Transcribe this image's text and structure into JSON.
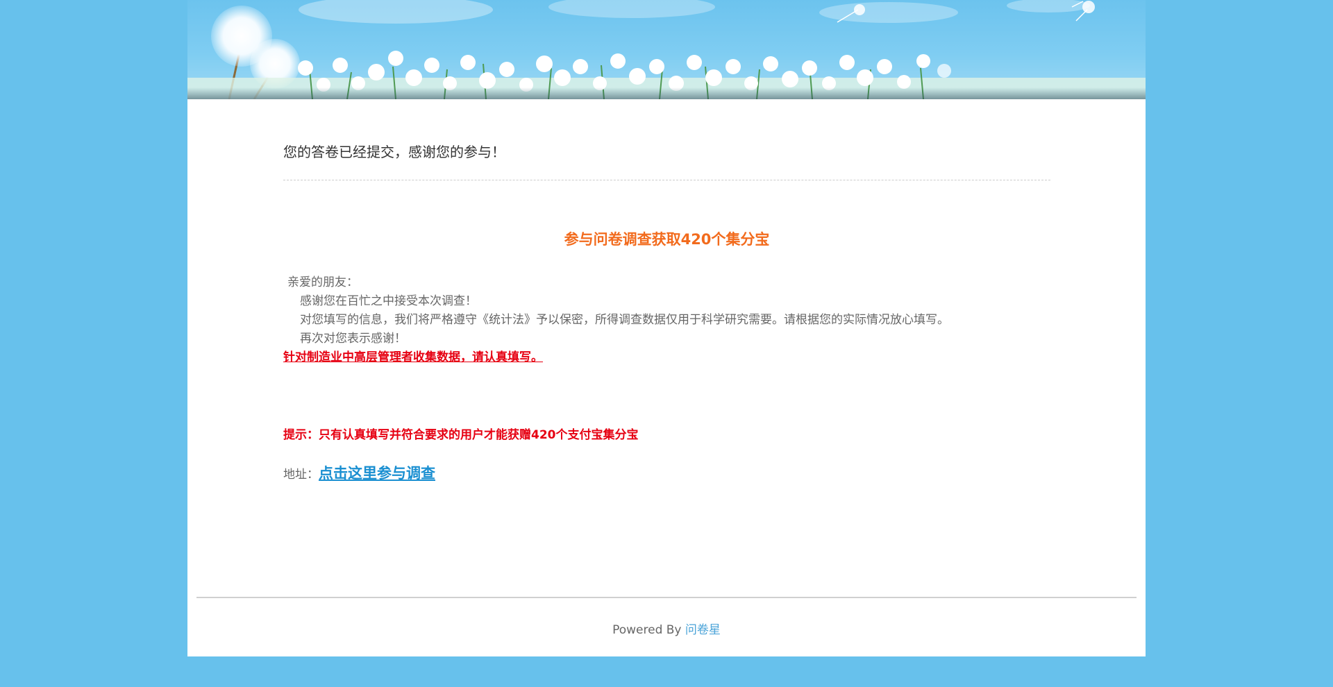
{
  "page": {
    "background_color": "#67c1ec"
  },
  "banner": {
    "image": "dandelion-field-illustration"
  },
  "main": {
    "submitted_title": "您的答卷已经提交，感谢您的参与！",
    "promo_title": "参与问卷调查获取420个集分宝",
    "greeting": "亲爱的朋友：",
    "paragraphs": [
      "感谢您在百忙之中接受本次调查！",
      "对您填写的信息，我们将严格遵守《统计法》予以保密，所得调查数据仅用于科学研究需要。请根据您的实际情况放心填写。",
      "再次对您表示感谢！"
    ],
    "target_notice": "针对制造业中高层管理者收集数据，请认真填写。",
    "tip": "提示：只有认真填写并符合要求的用户才能获赠420个支付宝集分宝",
    "address_label": "地址：",
    "address_link": "点击这里参与调查"
  },
  "footer": {
    "powered_by": "Powered By",
    "brand": "问卷星"
  },
  "colors": {
    "promo_orange": "#f26b1d",
    "notice_red": "#e60012",
    "link_blue": "#1a8fd1",
    "footer_link": "#4aa3d8"
  }
}
